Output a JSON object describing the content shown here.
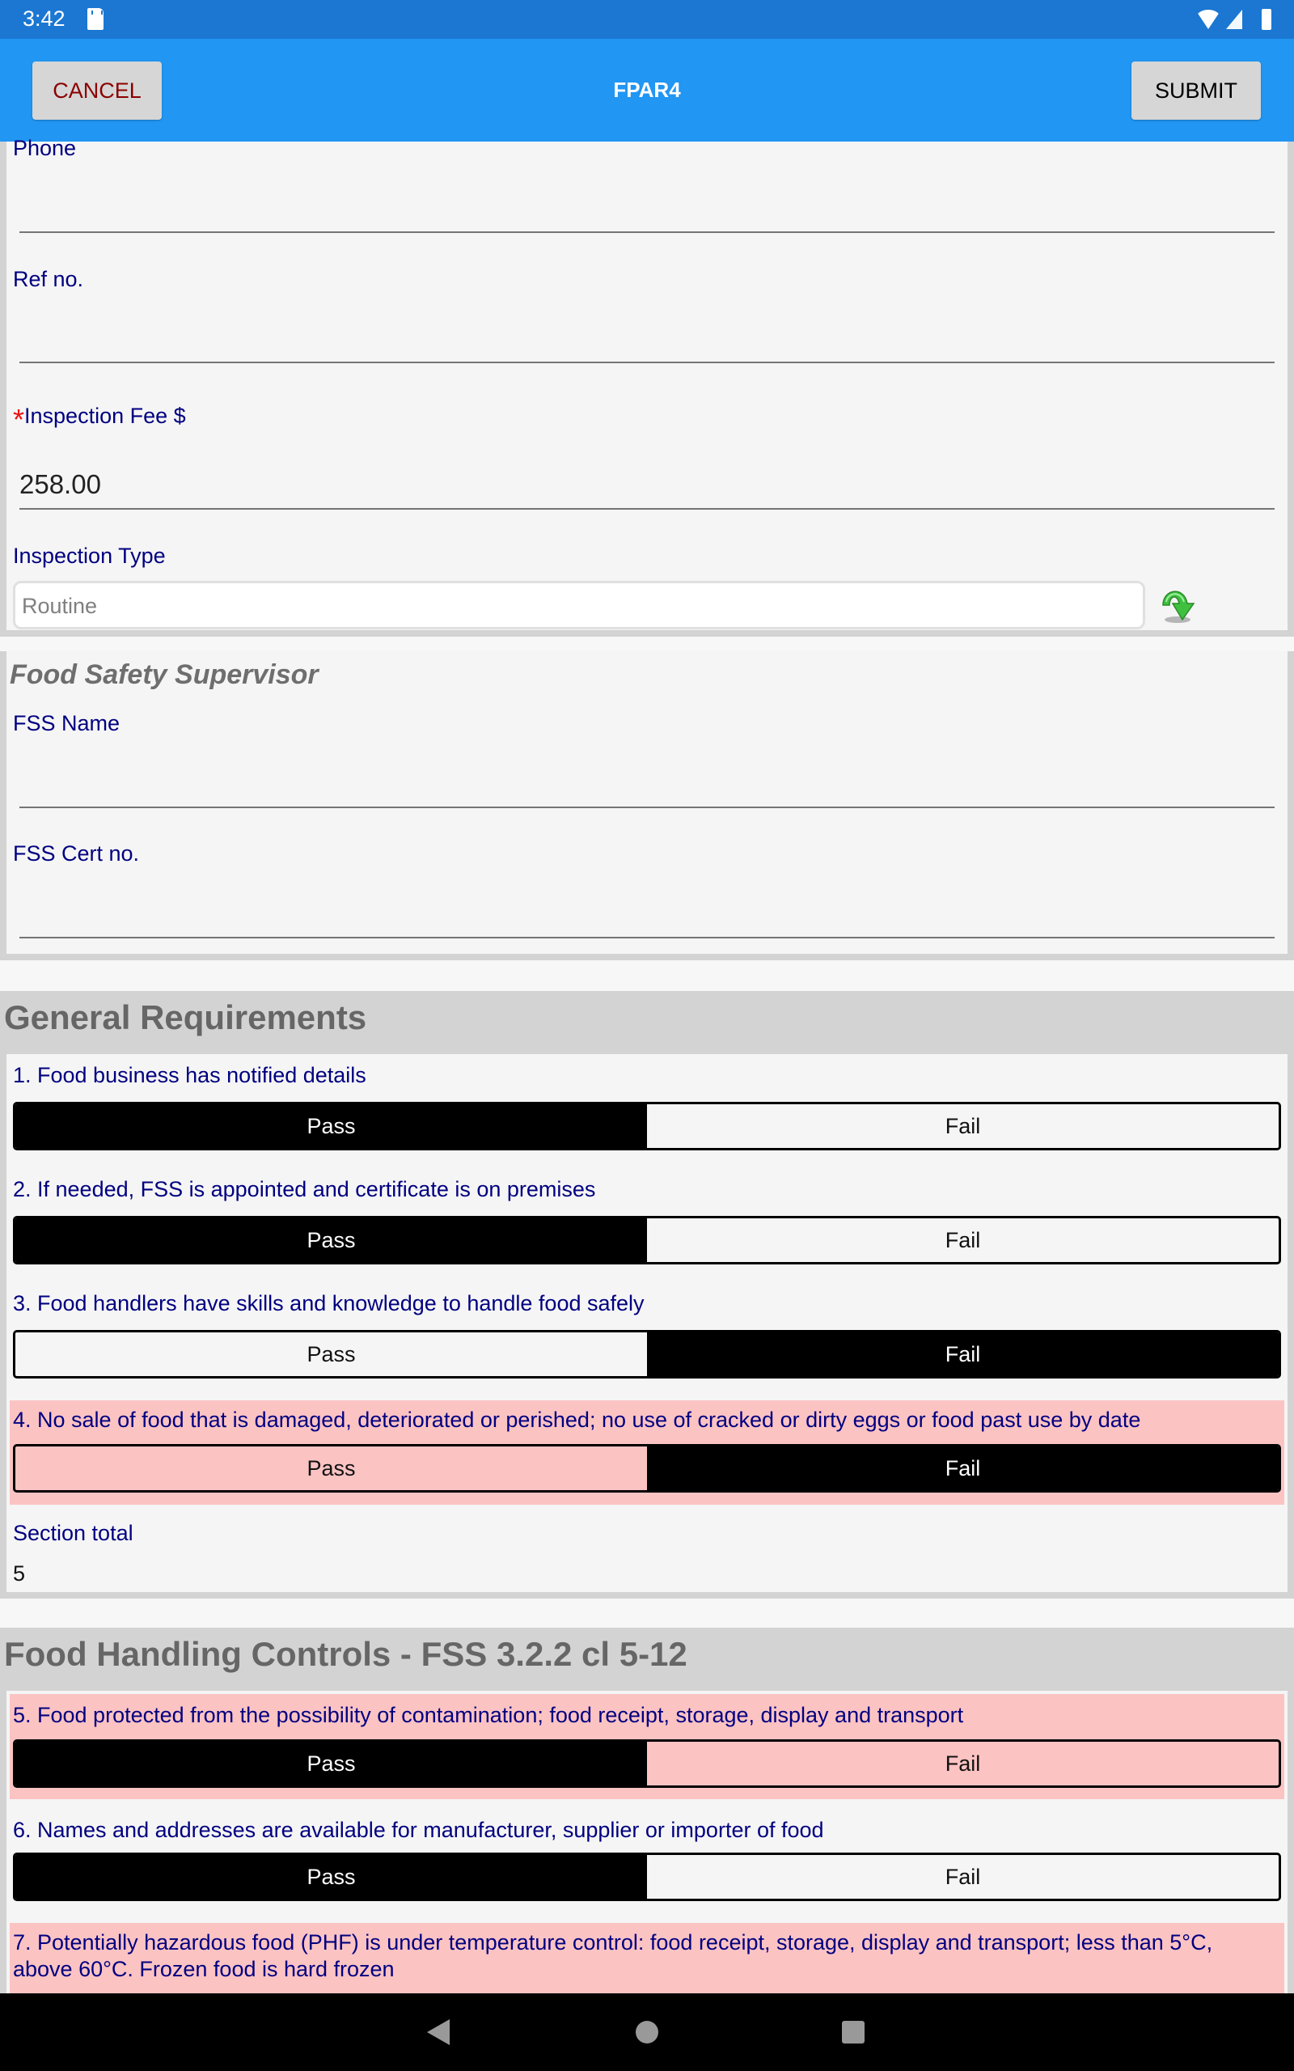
{
  "status_bar": {
    "time": "3:42",
    "icons": [
      "sd-card-icon",
      "wifi-icon",
      "signal-icon",
      "battery-icon"
    ]
  },
  "app_bar": {
    "title": "FPAR4",
    "cancel_label": "CANCEL",
    "submit_label": "SUBMIT"
  },
  "colors": {
    "status_bar": "#1b77d2",
    "app_bar": "#2196f3",
    "label_text": "#000080",
    "cancel_text": "#8b0000",
    "flagged_row": "#fcc3c3",
    "selected_option": "#000000",
    "required_star": "#ee1111"
  },
  "business_details": {
    "phone": {
      "label": "Phone",
      "value": ""
    },
    "ref_no": {
      "label": "Ref no.",
      "value": ""
    },
    "inspection_fee": {
      "label": "Inspection Fee $",
      "required": true,
      "required_marker": "*",
      "value": "258.00"
    },
    "inspection_type": {
      "label": "Inspection Type",
      "placeholder": "Routine",
      "icon": "dropdown-arrow-icon"
    }
  },
  "food_safety_supervisor": {
    "heading": "Food Safety Supervisor",
    "fss_name": {
      "label": "FSS Name",
      "value": ""
    },
    "fss_cert_no": {
      "label": "FSS Cert no.",
      "value": ""
    }
  },
  "sections": [
    {
      "title": "General Requirements",
      "questions": [
        {
          "label": "1. Food business has notified details",
          "options": [
            "Pass",
            "Fail"
          ],
          "selected": "Pass",
          "flagged": false
        },
        {
          "label": "2. If needed, FSS is appointed and certificate is on premises",
          "options": [
            "Pass",
            "Fail"
          ],
          "selected": "Pass",
          "flagged": false
        },
        {
          "label": "3. Food handlers have skills and knowledge to handle food safely",
          "options": [
            "Pass",
            "Fail"
          ],
          "selected": "Fail",
          "flagged": false
        },
        {
          "label": "4. No sale of food that is damaged, deteriorated or perished; no use of cracked or dirty eggs or food past use by date",
          "options": [
            "Pass",
            "Fail"
          ],
          "selected": "Fail",
          "flagged": true
        }
      ],
      "total_label": "Section total",
      "total_value": "5"
    },
    {
      "title": "Food Handling Controls - FSS 3.2.2 cl 5-12",
      "questions": [
        {
          "label": "5. Food protected from the possibility of contamination; food receipt, storage, display and transport",
          "options": [
            "Pass",
            "Fail"
          ],
          "selected": "Pass",
          "flagged": true
        },
        {
          "label": "6. Names and addresses are available for manufacturer, supplier or importer of food",
          "options": [
            "Pass",
            "Fail"
          ],
          "selected": "Pass",
          "flagged": false
        },
        {
          "label": "7. Potentially hazardous food (PHF) is under temperature control: food receipt, storage, display and transport; less than 5°C, above 60°C. Frozen food is hard frozen",
          "flagged": true
        }
      ]
    }
  ],
  "nav_bar": {
    "icons": [
      "back-icon",
      "home-icon",
      "recent-apps-icon"
    ]
  }
}
